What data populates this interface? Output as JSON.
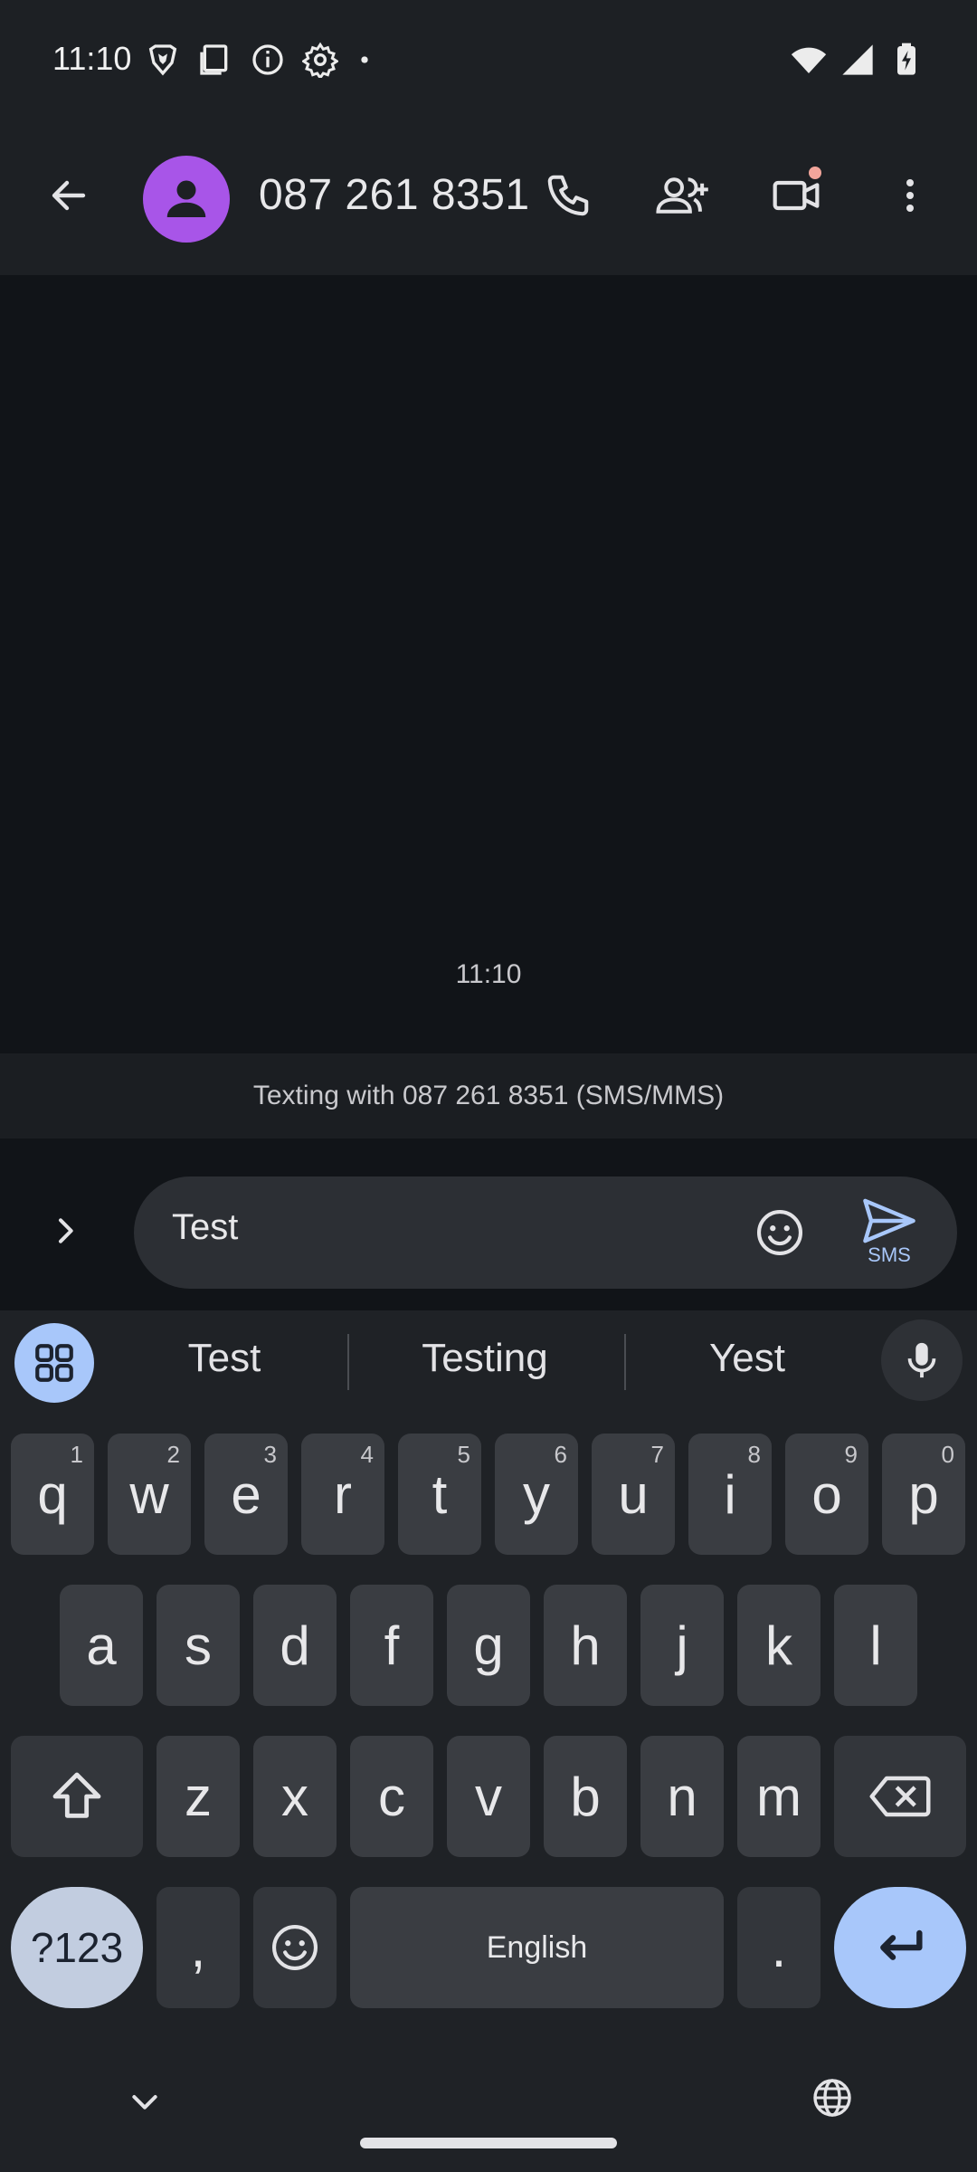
{
  "status_bar": {
    "time": "11:10",
    "left_icons": [
      "brave-shield-icon",
      "screenshot-icon",
      "info-icon",
      "settings-gear-icon",
      "dot-icon"
    ],
    "right_icons": [
      "wifi-icon",
      "signal-icon",
      "battery-charging-icon"
    ]
  },
  "app_bar": {
    "title": "087 261 8351",
    "actions": [
      "phone-icon",
      "add-person-icon",
      "video-call-icon",
      "more-vert-icon"
    ],
    "avatar_color": "#a855e8",
    "video_notification_dot_color": "#f2a59b"
  },
  "conversation": {
    "timestamp": "11:10"
  },
  "banner": {
    "text": "Texting with 087 261 8351 (SMS/MMS)"
  },
  "compose": {
    "value": "Test",
    "send_label": "SMS",
    "accent": "#a8c7fa"
  },
  "keyboard": {
    "suggestions": [
      "Test",
      "Testing",
      "Yest"
    ],
    "row1": [
      {
        "k": "q",
        "h": "1"
      },
      {
        "k": "w",
        "h": "2"
      },
      {
        "k": "e",
        "h": "3"
      },
      {
        "k": "r",
        "h": "4"
      },
      {
        "k": "t",
        "h": "5"
      },
      {
        "k": "y",
        "h": "6"
      },
      {
        "k": "u",
        "h": "7"
      },
      {
        "k": "i",
        "h": "8"
      },
      {
        "k": "o",
        "h": "9"
      },
      {
        "k": "p",
        "h": "0"
      }
    ],
    "row2": [
      "a",
      "s",
      "d",
      "f",
      "g",
      "h",
      "j",
      "k",
      "l"
    ],
    "row3": [
      "z",
      "x",
      "c",
      "v",
      "b",
      "n",
      "m"
    ],
    "symbols_label": "?123",
    "comma": ",",
    "space_label": "English",
    "period": "."
  }
}
